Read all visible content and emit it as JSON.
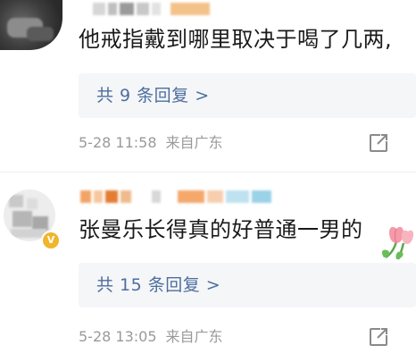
{
  "comments": [
    {
      "content": "他戒指戴到哪里取决于喝了几两,",
      "replies_label": "共 9 条回复 >",
      "time": "5-28 11:58",
      "location": "来自广东"
    },
    {
      "content": "张曼乐长得真的好普通一男的",
      "replies_label": "共 15 条回复 >",
      "time": "5-28 13:05",
      "location": "来自广东",
      "badge": "V"
    }
  ],
  "colors": {
    "link": "#4d6e9e",
    "meta": "#9a9a9a",
    "reply_bg": "#f5f6f8",
    "badge": "#f0b52b"
  },
  "icons": {
    "share": "share-icon",
    "emoji": "tulip-emoji-icon"
  }
}
